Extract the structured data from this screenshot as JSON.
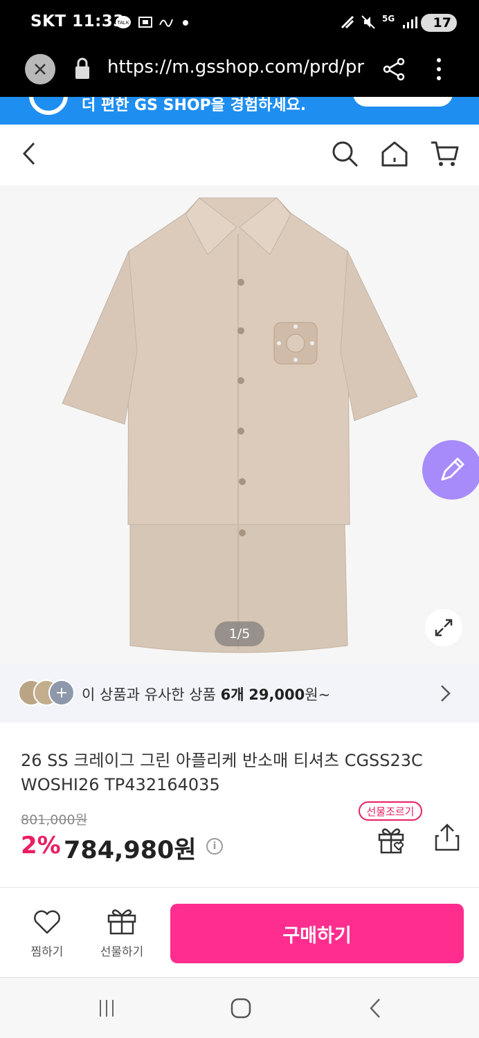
{
  "status_bar": {
    "carrier": "SKT 11:33",
    "battery": "17",
    "network": "5G"
  },
  "browser": {
    "url": "https://m.gsshop.com/prd/pr"
  },
  "banner": {
    "text": "더 편한 GS SHOP을 경험하세요."
  },
  "gallery": {
    "counter": "1/5"
  },
  "similar": {
    "prefix": "이 상품과 유사한 상품 ",
    "count": "6개",
    "price": "29,000",
    "suffix": "원~"
  },
  "product": {
    "title": "26 SS 크레이그 그린 아플리케 반소매 티셔츠 CGSS23C WOSHI26 TP432164035",
    "original_price": "801,000원",
    "discount": "2%",
    "price": "784,980원",
    "gift_tag": "선물조르기",
    "info_icon": "i"
  },
  "actions": {
    "wish_label": "찜하기",
    "gift_label": "선물하기",
    "buy_label": "구매하기"
  },
  "colors": {
    "accent_pink": "#ff2d8e",
    "discount_pink": "#e91e63",
    "banner_blue": "#1f8ef1",
    "fab_purple": "#a78bfa",
    "product_beige": "#d8c8b8"
  }
}
